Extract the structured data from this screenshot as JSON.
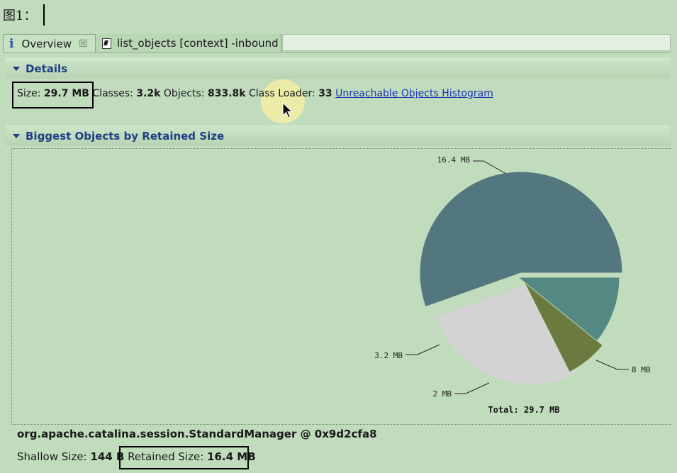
{
  "caption": "图1：",
  "tabs": [
    {
      "label": "Overview",
      "icon": "info-icon",
      "active": true
    },
    {
      "label": "list_objects [context] -inbound",
      "icon": "document-icon",
      "active": false
    }
  ],
  "details": {
    "title": "Details",
    "size_label": "Size:",
    "size_value": "29.7 MB",
    "classes_label": "Classes:",
    "classes_value": "3.2k",
    "objects_label": "Objects:",
    "objects_value": "833.8k",
    "loader_label": "Class Loader:",
    "loader_value": "33",
    "link": "Unreachable Objects Histogram"
  },
  "biggest": {
    "title": "Biggest Objects by Retained Size"
  },
  "chart_data": {
    "type": "pie",
    "slices": [
      {
        "label": "16.4 MB",
        "value": 16.4,
        "color": "#52777f"
      },
      {
        "label": "8 MB",
        "value": 8.0,
        "color": "#d3d3d3"
      },
      {
        "label": "2 MB",
        "value": 2.0,
        "color": "#6b7a3e"
      },
      {
        "label": "3.2 MB",
        "value": 3.2,
        "color": "#538982"
      }
    ],
    "total_label": "Total: 29.7 MB"
  },
  "selected_object": {
    "name": "org.apache.catalina.session.StandardManager @ 0x9d2cfa8",
    "shallow_label": "Shallow Size:",
    "shallow_value": "144 B",
    "retained_label": "Retained Size:",
    "retained_value": "16.4 MB"
  }
}
